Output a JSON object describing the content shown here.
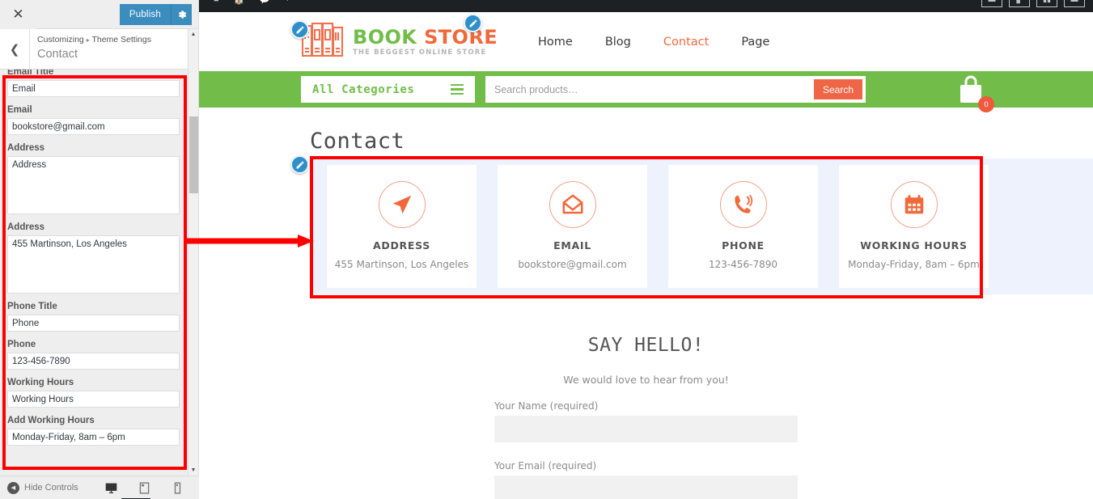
{
  "customizer": {
    "close_icon": "close-icon",
    "publish_label": "Publish",
    "gear_icon": "gear-icon",
    "back_icon": "chevron-left-icon",
    "breadcrumb_root": "Customizing",
    "breadcrumb_sep": "▸",
    "breadcrumb_section": "Theme Settings",
    "page_title": "Contact",
    "fields": [
      {
        "label": "Email Title",
        "value": "Email",
        "type": "text"
      },
      {
        "label": "Email",
        "value": "bookstore@gmail.com",
        "type": "text"
      },
      {
        "label": "Address",
        "value": "Address",
        "type": "textarea"
      },
      {
        "label": "Address",
        "value": "455 Martinson, Los Angeles",
        "type": "textarea"
      },
      {
        "label": "Phone Title",
        "value": "Phone",
        "type": "text"
      },
      {
        "label": "Phone",
        "value": "123-456-7890",
        "type": "text"
      },
      {
        "label": "Working Hours",
        "value": "Working Hours",
        "type": "text"
      },
      {
        "label": "Add Working Hours",
        "value": "Monday-Friday, 8am – 6pm",
        "type": "text"
      }
    ],
    "hide_controls_label": "Hide Controls",
    "devices": [
      {
        "name": "desktop",
        "active": true
      },
      {
        "name": "tablet",
        "active": false
      },
      {
        "name": "mobile",
        "active": false
      }
    ]
  },
  "site": {
    "logo": {
      "brand_part1": "BOOK",
      "brand_part2": "STORE",
      "tagline": "THE BEGGEST ONLINE STORE"
    },
    "nav": [
      {
        "label": "Home",
        "active": false
      },
      {
        "label": "Blog",
        "active": false
      },
      {
        "label": "Contact",
        "active": true
      },
      {
        "label": "Page",
        "active": false
      }
    ],
    "search": {
      "categories_label": "All Categories",
      "placeholder": "Search products…",
      "button_label": "Search"
    },
    "cart": {
      "count": "0"
    },
    "page_heading": "Contact"
  },
  "contact_cards": [
    {
      "icon": "paper-plane-icon",
      "title": "ADDRESS",
      "value": "455 Martinson, Los Angeles"
    },
    {
      "icon": "envelope-icon",
      "title": "EMAIL",
      "value": "bookstore@gmail.com"
    },
    {
      "icon": "phone-icon",
      "title": "PHONE",
      "value": "123-456-7890"
    },
    {
      "icon": "calendar-icon",
      "title": "WORKING HOURS",
      "value": "Monday-Friday, 8am – 6pm"
    }
  ],
  "contact_form": {
    "heading": "SAY HELLO!",
    "subheading": "We would love to hear from you!",
    "fields": [
      {
        "label": "Your Name (required)",
        "value": ""
      },
      {
        "label": "Your Email (required)",
        "value": ""
      }
    ]
  },
  "colors": {
    "brand_green": "#72bd4a",
    "brand_orange": "#f1693b",
    "search_button": "#ef6647",
    "publish_blue": "#3a8dbd",
    "annotation_red": "#fe0000",
    "card_band": "#edf2fd"
  }
}
